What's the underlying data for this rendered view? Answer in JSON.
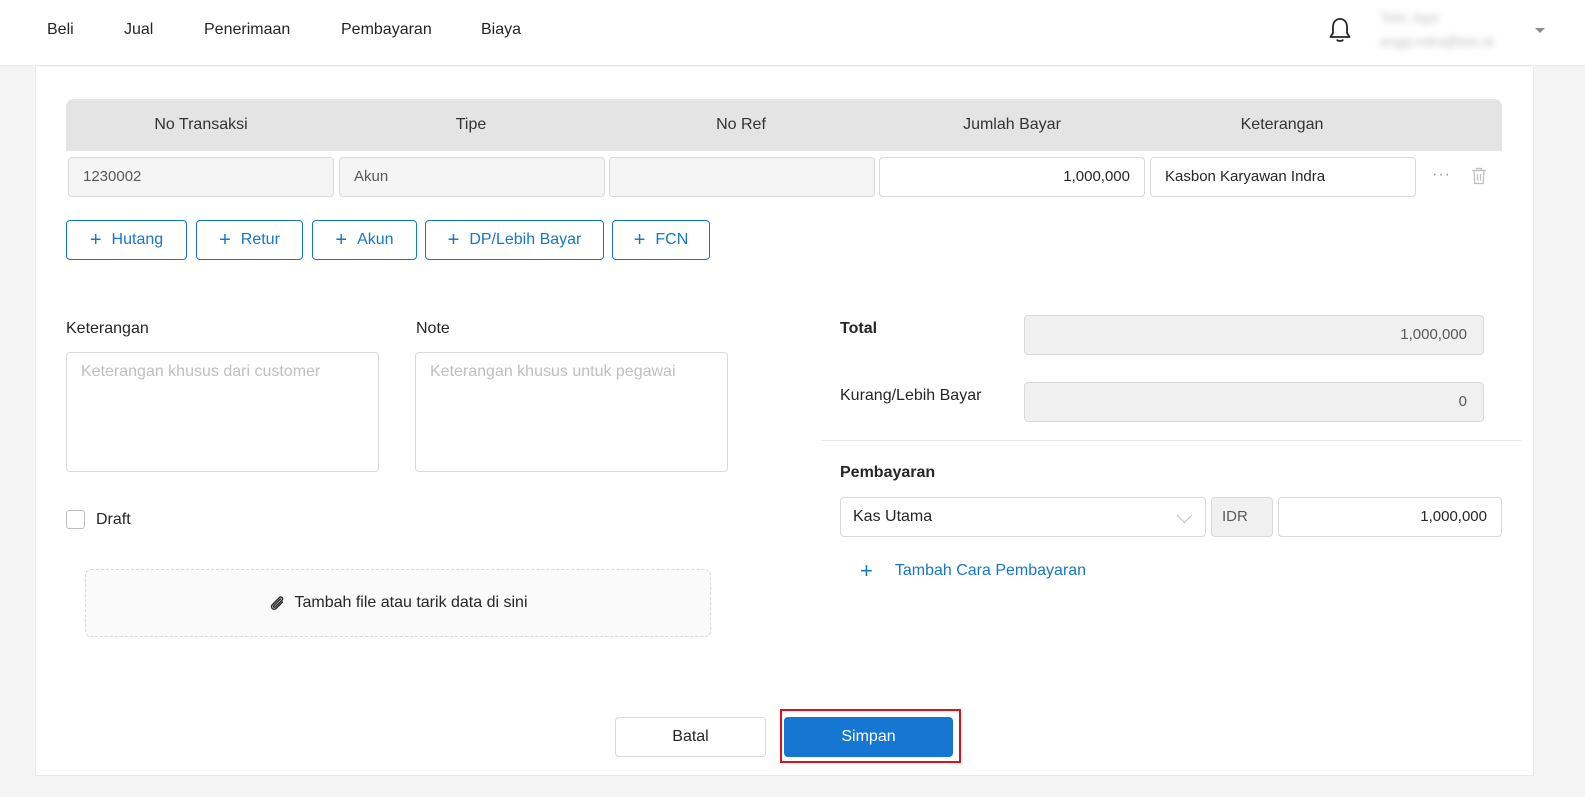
{
  "nav": {
    "items": [
      "Beli",
      "Jual",
      "Penerimaan",
      "Pembayaran",
      "Biaya"
    ]
  },
  "user": {
    "name": "Tobs Jaya",
    "email": "anggi.indra@bee.id"
  },
  "table": {
    "headers": [
      "No Transaksi",
      "Tipe",
      "No Ref",
      "Jumlah Bayar",
      "Keterangan"
    ],
    "row": {
      "no_transaksi": "1230002",
      "tipe": "Akun",
      "no_ref": "",
      "jumlah_bayar": "1,000,000",
      "keterangan": "Kasbon Karyawan Indra"
    }
  },
  "add_buttons": [
    "Hutang",
    "Retur",
    "Akun",
    "DP/Lebih Bayar",
    "FCN"
  ],
  "form": {
    "keterangan_label": "Keterangan",
    "keterangan_placeholder": "Keterangan khusus dari customer",
    "note_label": "Note",
    "note_placeholder": "Keterangan khusus untuk pegawai",
    "draft_label": "Draft",
    "attach_label": "Tambah file atau tarik data di sini"
  },
  "summary": {
    "total_label": "Total",
    "total_value": "1,000,000",
    "kurang_label": "Kurang/Lebih Bayar",
    "kurang_value": "0"
  },
  "payment": {
    "label": "Pembayaran",
    "method": "Kas Utama",
    "currency": "IDR",
    "amount": "1,000,000",
    "add_label": "Tambah Cara Pembayaran"
  },
  "actions": {
    "cancel": "Batal",
    "save": "Simpan"
  },
  "colors": {
    "primary": "#1677d2",
    "highlight": "#e0101a"
  }
}
